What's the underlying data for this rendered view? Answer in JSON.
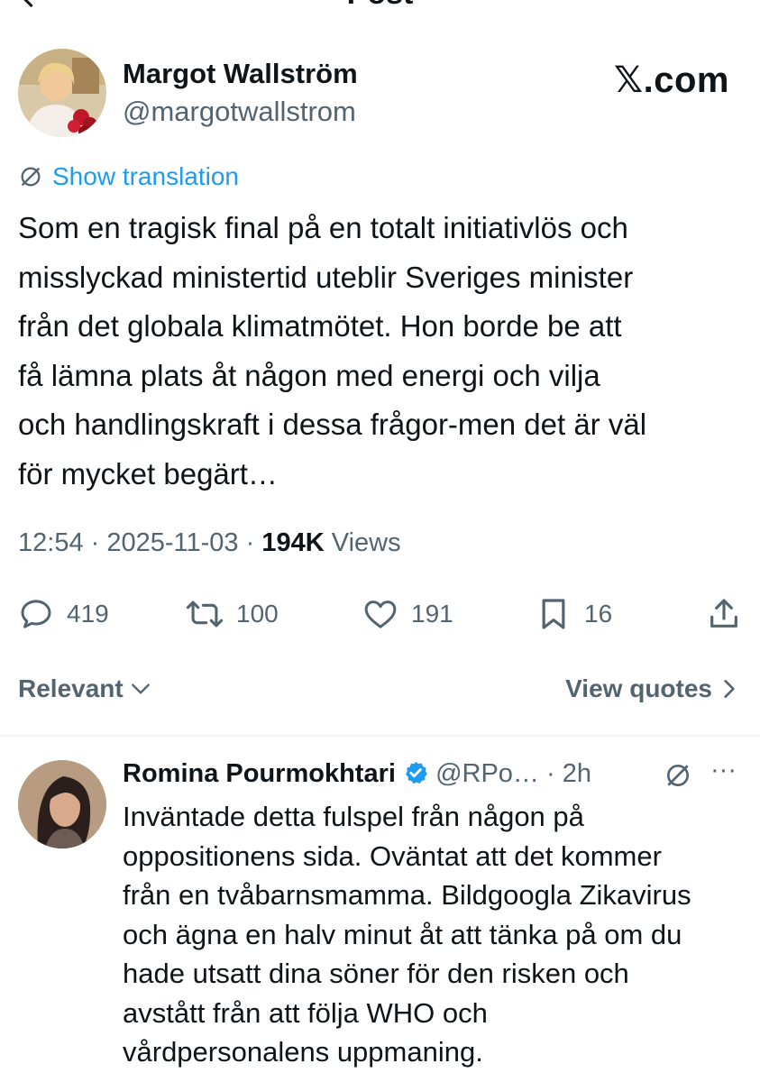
{
  "header": {
    "title": "Post"
  },
  "post": {
    "author_name": "Margot Wallström",
    "author_handle": "@margotwallstrom",
    "watermark": "𝕏.com",
    "translate_label": "Show translation",
    "text": "Som en tragisk final på en totalt initiativlös och\nmisslyckad ministertid uteblir Sveriges minister\nfrån det globala klimatmötet. Hon borde be att\nfå lämna plats åt någon med energi och vilja\noch handlingskraft i dessa frågor-men det är väl\nför mycket begärt…",
    "time": "12:54",
    "date": "2025-11-03",
    "views": "194K",
    "views_label": "Views",
    "separator": "·",
    "stats": {
      "replies": "419",
      "reposts": "100",
      "likes": "191",
      "bookmarks": "16"
    }
  },
  "sort": {
    "label": "Relevant",
    "view_quotes": "View quotes"
  },
  "reply": {
    "author_name": "Romina Pourmokhtari",
    "author_handle": "@RPo…",
    "time": "· 2h",
    "more": "···",
    "text": "Inväntade detta fulspel från någon på\noppositionens sida. Oväntat att det kommer\nfrån en tvåbarnsmamma. Bildgoogla Zikavirus\noch ägna en halv minut åt att tänka på om du\nhade utsatt dina söner för den risken och\navstått från att följa WHO och\nvårdpersonalens uppmaning."
  },
  "colors": {
    "accent": "#1d9bf0",
    "secondary_text": "#536471",
    "primary_text": "#0f1419"
  },
  "icons": [
    "back-arrow-icon",
    "translate-icon",
    "reply-icon",
    "repost-icon",
    "like-icon",
    "bookmark-icon",
    "share-icon",
    "chevron-down-icon",
    "chevron-right-icon",
    "verified-icon"
  ]
}
